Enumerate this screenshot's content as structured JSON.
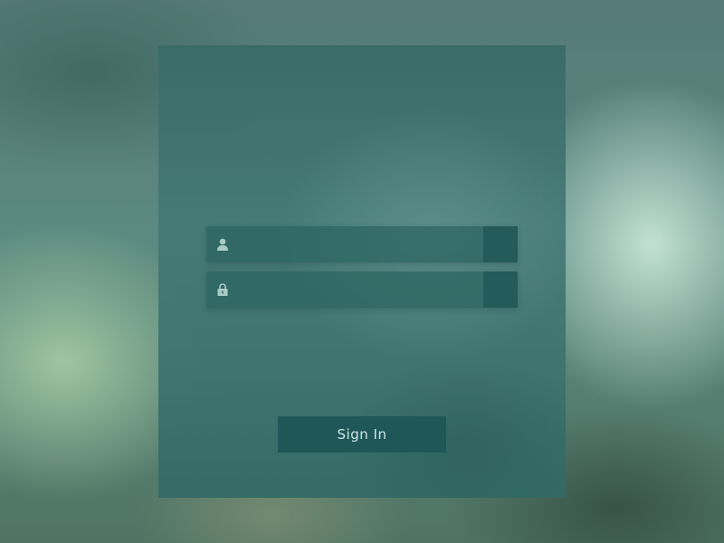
{
  "form": {
    "username": {
      "value": "",
      "placeholder": "",
      "icon": "user-icon"
    },
    "password": {
      "value": "",
      "placeholder": "",
      "icon": "lock-icon"
    },
    "sign_in_label": "Sign In"
  },
  "colors": {
    "panel": "#3f7470",
    "field": "#2c6462",
    "field_button": "#245a59",
    "button": "#1f5759",
    "button_text": "#cfe6e4",
    "icon": "#a9cbc6"
  }
}
